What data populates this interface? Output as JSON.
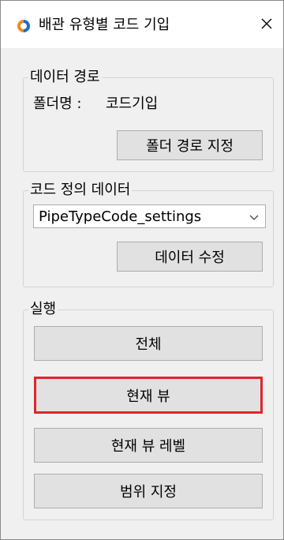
{
  "window": {
    "title": "배관 유형별 코드 기입",
    "close_label": "✕"
  },
  "data_path": {
    "group_title": "데이터 경로",
    "folder_label": "폴더명 :",
    "folder_value": "코드기입",
    "set_path_button": "폴더 경로 지정"
  },
  "code_data": {
    "group_title": "코드 정의 데이터",
    "selected_option": "PipeTypeCode_settings",
    "edit_button": "데이터 수정"
  },
  "run": {
    "group_title": "실행",
    "buttons": [
      {
        "label": "전체"
      },
      {
        "label": "현재 뷰"
      },
      {
        "label": "현재 뷰 레벨"
      },
      {
        "label": "범위 지정"
      }
    ],
    "active_index": 1
  },
  "colors": {
    "icon_primary": "#1e6fc2",
    "icon_secondary": "#f08a1c",
    "active_border": "#e0242f"
  },
  "icons": {
    "app": "app-logo-icon",
    "close": "close-icon",
    "dropdown": "chevron-down-icon"
  }
}
